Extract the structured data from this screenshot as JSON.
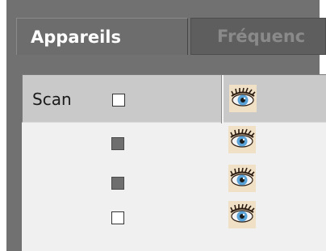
{
  "tabs": [
    {
      "label": "Appareils",
      "active": true
    },
    {
      "label": "Fréquenc",
      "active": false
    }
  ],
  "table": {
    "header": {
      "label": "Scan",
      "checked": false,
      "icon": "eye-icon"
    },
    "rows": [
      {
        "checked": false,
        "disabled": true,
        "icon": "eye-icon"
      },
      {
        "checked": false,
        "disabled": true,
        "icon": "eye-icon"
      },
      {
        "checked": false,
        "disabled": false,
        "icon": "eye-icon"
      }
    ]
  },
  "colors": {
    "frame": "#717171",
    "panel": "#f0f0f0",
    "header": "#c9c9c9",
    "eye_iris": "#5aa3d8"
  }
}
